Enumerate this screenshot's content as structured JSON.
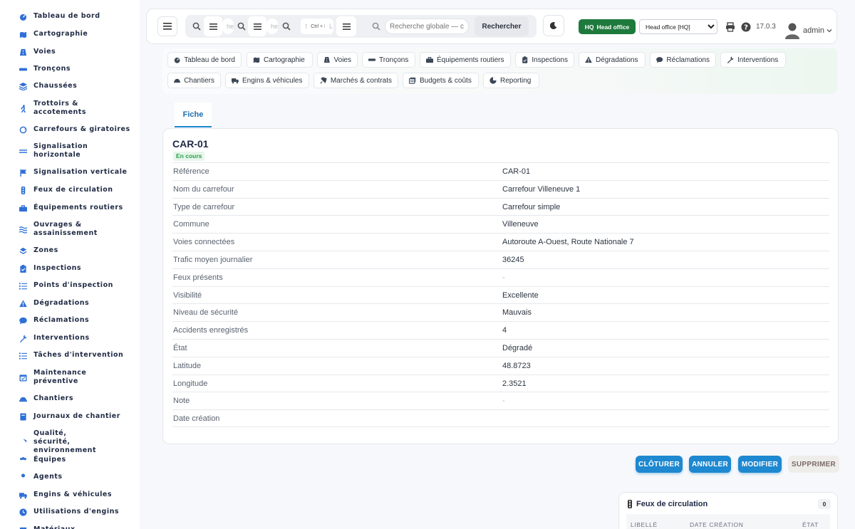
{
  "sidebar": {
    "items": [
      {
        "label": "Tableau de bord",
        "icon": "gauge-icon"
      },
      {
        "label": "Cartographie",
        "icon": "map-icon"
      },
      {
        "label": "Voies",
        "icon": "road-icon"
      },
      {
        "label": "Tronçons",
        "icon": "segment-icon"
      },
      {
        "label": "Chaussées",
        "icon": "layers-icon"
      },
      {
        "label": "Trottoirs & accotements",
        "icon": "walk-icon"
      },
      {
        "label": "Carrefours & giratoires",
        "icon": "roundabout-icon"
      },
      {
        "label": "Signalisation horizontale",
        "icon": "lines-icon"
      },
      {
        "label": "Signalisation verticale",
        "icon": "sign-icon"
      },
      {
        "label": "Feux de circulation",
        "icon": "traffic-light-icon"
      },
      {
        "label": "Équipements routiers",
        "icon": "toolbox-icon"
      },
      {
        "label": "Ouvrages & assainissement",
        "icon": "water-icon"
      },
      {
        "label": "Zones",
        "icon": "zones-icon"
      },
      {
        "label": "Inspections",
        "icon": "clipboard-icon"
      },
      {
        "label": "Points d'inspection",
        "icon": "list-icon"
      },
      {
        "label": "Dégradations",
        "icon": "warning-icon"
      },
      {
        "label": "Réclamations",
        "icon": "comment-icon"
      },
      {
        "label": "Interventions",
        "icon": "wrench-icon"
      },
      {
        "label": "Tâches d'intervention",
        "icon": "tasks-icon"
      },
      {
        "label": "Maintenance préventive",
        "icon": "calendar-icon"
      },
      {
        "label": "Chantiers",
        "icon": "hardhat-icon"
      },
      {
        "label": "Journaux de chantier",
        "icon": "book-icon"
      },
      {
        "label": "Qualité, sécurité, environnement",
        "icon": "shield-icon"
      },
      {
        "label": "Équipes",
        "icon": "users-icon"
      },
      {
        "label": "Agents",
        "icon": "user-icon"
      },
      {
        "label": "Engins & véhicules",
        "icon": "truck-icon"
      },
      {
        "label": "Utilisations d'engins",
        "icon": "clock-icon"
      },
      {
        "label": "Matériaux",
        "icon": "box-icon"
      }
    ]
  },
  "topbar": {
    "ghost_inputs": [
      "he",
      "he",
      "L"
    ],
    "kbd_hint": "Ctrl + K",
    "search_placeholder": "Recherche globale — c",
    "search_button": "Rechercher",
    "hq_code": "HQ",
    "hq_name": "Head office",
    "site_select": "Head office [HQ]",
    "version": "17.0.3",
    "user": "admin"
  },
  "modules": [
    {
      "label": "Tableau de bord",
      "icon": "gauge-icon"
    },
    {
      "label": "Cartographie",
      "icon": "map-icon"
    },
    {
      "label": "Voies",
      "icon": "road-icon"
    },
    {
      "label": "Tronçons",
      "icon": "segment-icon"
    },
    {
      "label": "Équipements routiers",
      "icon": "toolbox-icon"
    },
    {
      "label": "Inspections",
      "icon": "clipboard-icon"
    },
    {
      "label": "Dégradations",
      "icon": "warning-icon"
    },
    {
      "label": "Réclamations",
      "icon": "comment-icon"
    },
    {
      "label": "Interventions",
      "icon": "wrench-icon"
    },
    {
      "label": "Chantiers",
      "icon": "hardhat-icon"
    },
    {
      "label": "Engins & véhicules",
      "icon": "truck-icon"
    },
    {
      "label": "Marchés & contrats",
      "icon": "contract-icon"
    },
    {
      "label": "Budgets & coûts",
      "icon": "coins-icon"
    },
    {
      "label": "Reporting",
      "icon": "pie-icon"
    }
  ],
  "tab": {
    "label": "Fiche"
  },
  "record": {
    "title": "CAR-01",
    "status": "En cours",
    "fields": [
      {
        "key": "Référence",
        "value": "CAR-01"
      },
      {
        "key": "Nom du carrefour",
        "value": "Carrefour Villeneuve 1"
      },
      {
        "key": "Type de carrefour",
        "value": "Carrefour simple"
      },
      {
        "key": "Commune",
        "value": "Villeneuve"
      },
      {
        "key": "Voies connectées",
        "value": "Autoroute A-Ouest, Route Nationale 7"
      },
      {
        "key": "Trafic moyen journalier",
        "value": "36245"
      },
      {
        "key": "Feux présents",
        "value": "-"
      },
      {
        "key": "Visibilité",
        "value": "Excellente"
      },
      {
        "key": "Niveau de sécurité",
        "value": "Mauvais"
      },
      {
        "key": "Accidents enregistrés",
        "value": "4"
      },
      {
        "key": "État",
        "value": "Dégradé"
      },
      {
        "key": "Latitude",
        "value": "48.8723"
      },
      {
        "key": "Longitude",
        "value": "2.3521"
      },
      {
        "key": "Note",
        "value": "-"
      },
      {
        "key": "Date création",
        "value": ""
      }
    ]
  },
  "actions": {
    "close": "CLÔTURER",
    "cancel": "ANNULER",
    "edit": "MODIFIER",
    "delete": "SUPPRIMER"
  },
  "panel": {
    "title": "Feux de circulation",
    "count": "0",
    "columns": [
      "LIBELLÉ",
      "DATE CRÉATION",
      "ÉTAT"
    ]
  },
  "colors": {
    "accent": "#1e88d0",
    "sidebar_icon": "#2f6fd6",
    "hq_green": "#1e7a3c",
    "status_green": "#2a9d4c"
  }
}
